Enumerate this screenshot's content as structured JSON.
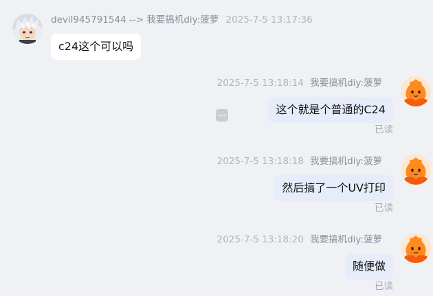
{
  "messages": [
    {
      "direction": "incoming",
      "sender": "devil945791544",
      "arrow": "-->",
      "group": "我要搞机diy:菠萝",
      "time": "2025-7-5 13:17:36",
      "text": "c24这个可以吗",
      "avatar_icon": "anime-character-avatar-icon"
    },
    {
      "direction": "outgoing",
      "time": "2025-7-5 13:18:14",
      "sender": "我要搞机diy:菠萝",
      "text": "这个就是个普通的C24",
      "status": "已读",
      "avatar_icon": "orange-mascot-avatar-icon",
      "has_more_button": true
    },
    {
      "direction": "outgoing",
      "time": "2025-7-5 13:18:18",
      "sender": "我要搞机diy:菠萝",
      "text": "然后搞了一个UV打印",
      "status": "已读",
      "avatar_icon": "orange-mascot-avatar-icon"
    },
    {
      "direction": "outgoing",
      "time": "2025-7-5 13:18:20",
      "sender": "我要搞机diy:菠萝",
      "text": "随便做",
      "status": "已读",
      "avatar_icon": "orange-mascot-avatar-icon"
    }
  ],
  "colors": {
    "background": "#f0f1f5",
    "incoming_bubble": "#ffffff",
    "outgoing_bubble": "#e7ecfa",
    "meta_text": "#9ea3ad",
    "mascot_orange": "#ff8a1e"
  }
}
